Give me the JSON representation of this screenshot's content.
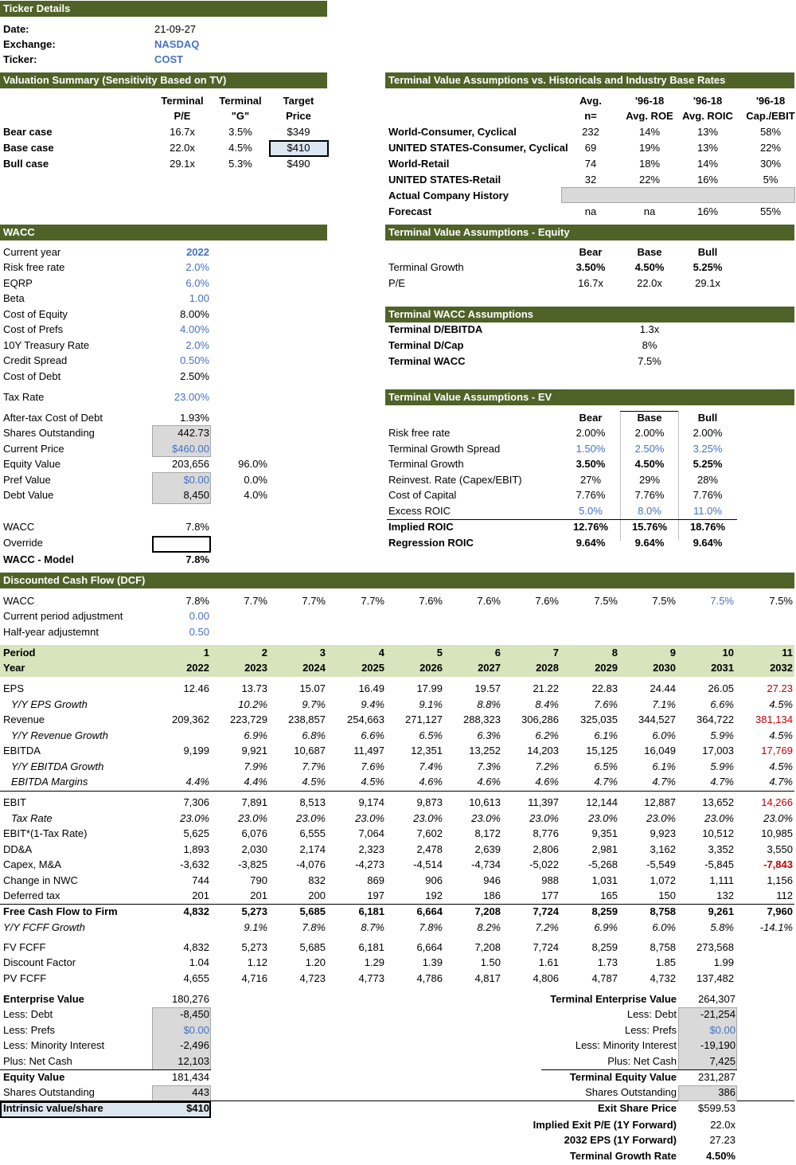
{
  "ticker": {
    "header": "Ticker Details",
    "date_label": "Date:",
    "date": "21-09-27",
    "exchange_label": "Exchange:",
    "exchange": "NASDAQ",
    "ticker_label": "Ticker:",
    "ticker": "COST"
  },
  "valuation": {
    "header": "Valuation Summary (Sensitivity Based on TV)",
    "col_headers": [
      [
        "Terminal",
        "P/E"
      ],
      [
        "Terminal",
        "\"G\""
      ],
      [
        "Target",
        "Price"
      ]
    ],
    "rows": [
      {
        "label": "Bear case",
        "pe": "16.7x",
        "g": "3.5%",
        "price": "$349"
      },
      {
        "label": "Base case",
        "pe": "22.0x",
        "g": "4.5%",
        "price": "$410"
      },
      {
        "label": "Bull case",
        "pe": "29.1x",
        "g": "5.3%",
        "price": "$490"
      }
    ]
  },
  "tv_hist": {
    "header": "Terminal Value Assumptions vs. Historicals and Industry Base Rates",
    "col_headers": [
      [
        "Avg.",
        "n="
      ],
      [
        "'96-18",
        "Avg. ROE"
      ],
      [
        "'96-18",
        "Avg. ROIC"
      ],
      [
        "'96-18",
        "Cap./EBIT"
      ]
    ],
    "rows": [
      {
        "label": "World-Consumer, Cyclical",
        "v": [
          "232",
          "14%",
          "13%",
          "58%"
        ]
      },
      {
        "label": "UNITED STATES-Consumer, Cyclical",
        "v": [
          "69",
          "19%",
          "13%",
          "22%"
        ]
      },
      {
        "label": "World-Retail",
        "v": [
          "74",
          "18%",
          "14%",
          "30%"
        ]
      },
      {
        "label": "UNITED STATES-Retail",
        "v": [
          "32",
          "22%",
          "16%",
          "5%"
        ]
      },
      {
        "label": "Actual Company History",
        "v": [
          "",
          "",
          "",
          ""
        ]
      },
      {
        "label": "Forecast",
        "v": [
          "na",
          "na",
          "16%",
          "55%"
        ]
      }
    ]
  },
  "wacc": {
    "header": "WACC",
    "rows": [
      {
        "label": "Current year",
        "value": "2022",
        "pct": ""
      },
      {
        "label": "Risk free rate",
        "value": "2.0%",
        "pct": ""
      },
      {
        "label": "EQRP",
        "value": "6.0%",
        "pct": ""
      },
      {
        "label": "Beta",
        "value": "1.00",
        "pct": ""
      },
      {
        "label": "Cost of Equity",
        "value": "8.00%",
        "pct": ""
      },
      {
        "label": "Cost of Prefs",
        "value": "4.00%",
        "pct": ""
      },
      {
        "label": "10Y Treasury Rate",
        "value": "2.0%",
        "pct": ""
      },
      {
        "label": "Credit Spread",
        "value": "0.50%",
        "pct": ""
      },
      {
        "label": "Cost of Debt",
        "value": "2.50%",
        "pct": ""
      },
      {
        "label": "Tax Rate",
        "value": "23.00%",
        "pct": ""
      },
      {
        "label": "After-tax Cost of Debt",
        "value": "1.93%",
        "pct": ""
      },
      {
        "label": "Shares Outstanding",
        "value": "442.73",
        "pct": ""
      },
      {
        "label": "Current Price",
        "value": "$460.00",
        "pct": ""
      },
      {
        "label": "Equity Value",
        "value": "203,656",
        "pct": "96.0%"
      },
      {
        "label": "Pref Value",
        "value": "$0.00",
        "pct": "0.0%"
      },
      {
        "label": "Debt Value",
        "value": "8,450",
        "pct": "4.0%"
      },
      {
        "label": "WACC",
        "value": "7.8%",
        "pct": ""
      },
      {
        "label": "Override",
        "value": "",
        "pct": ""
      },
      {
        "label": "WACC - Model",
        "value": "7.8%",
        "pct": ""
      }
    ]
  },
  "tv_equity": {
    "header": "Terminal Value Assumptions - Equity",
    "cols": [
      "Bear",
      "Base",
      "Bull"
    ],
    "rows": [
      {
        "label": "Terminal Growth",
        "v": [
          "3.50%",
          "4.50%",
          "5.25%"
        ]
      },
      {
        "label": "P/E",
        "v": [
          "16.7x",
          "22.0x",
          "29.1x"
        ]
      }
    ]
  },
  "tv_wacc": {
    "header": "Terminal WACC Assumptions",
    "rows": [
      {
        "label": "Terminal D/EBITDA",
        "value": "1.3x"
      },
      {
        "label": "Terminal D/Cap",
        "value": "8%"
      },
      {
        "label": "Terminal WACC",
        "value": "7.5%"
      }
    ]
  },
  "tv_ev": {
    "header": "Terminal Value Assumptions - EV",
    "cols": [
      "Bear",
      "Base",
      "Bull"
    ],
    "rows": [
      {
        "label": "Risk free rate",
        "v": [
          "2.00%",
          "2.00%",
          "2.00%"
        ]
      },
      {
        "label": "Terminal Growth Spread",
        "v": [
          "1.50%",
          "2.50%",
          "3.25%"
        ]
      },
      {
        "label": "Terminal Growth",
        "v": [
          "3.50%",
          "4.50%",
          "5.25%"
        ]
      },
      {
        "label": "Reinvest. Rate (Capex/EBIT)",
        "v": [
          "27%",
          "29%",
          "28%"
        ]
      },
      {
        "label": "Cost of Capital",
        "v": [
          "7.76%",
          "7.76%",
          "7.76%"
        ]
      },
      {
        "label": "Excess ROIC",
        "v": [
          "5.0%",
          "8.0%",
          "11.0%"
        ]
      },
      {
        "label": "Implied ROIC",
        "v": [
          "12.76%",
          "15.76%",
          "18.76%"
        ]
      },
      {
        "label": "Regression ROIC",
        "v": [
          "9.64%",
          "9.64%",
          "9.64%"
        ]
      }
    ]
  },
  "dcf": {
    "header": "Discounted Cash Flow (DCF)",
    "wacc_label": "WACC",
    "wacc_values": [
      "7.8%",
      "7.7%",
      "7.7%",
      "7.7%",
      "7.6%",
      "7.6%",
      "7.6%",
      "7.5%",
      "7.5%",
      "7.5%",
      "7.5%"
    ],
    "current_adj_label": "Current period adjustment",
    "current_adj": "0.00",
    "half_year_label": "Half-year adjustemnt",
    "half_year": "0.50",
    "period_label": "Period",
    "periods": [
      "1",
      "2",
      "3",
      "4",
      "5",
      "6",
      "7",
      "8",
      "9",
      "10",
      "11"
    ],
    "year_label": "Year",
    "years": [
      "2022",
      "2023",
      "2024",
      "2025",
      "2026",
      "2027",
      "2028",
      "2029",
      "2030",
      "2031",
      "2032"
    ],
    "rows": [
      {
        "label": "EPS",
        "v": [
          "12.46",
          "13.73",
          "15.07",
          "16.49",
          "17.99",
          "19.57",
          "21.22",
          "22.83",
          "24.44",
          "26.05",
          "27.23"
        ]
      },
      {
        "label": "Y/Y EPS Growth",
        "v": [
          "",
          "10.2%",
          "9.7%",
          "9.4%",
          "9.1%",
          "8.8%",
          "8.4%",
          "7.6%",
          "7.1%",
          "6.6%",
          "4.5%"
        ]
      },
      {
        "label": "Revenue",
        "v": [
          "209,362",
          "223,729",
          "238,857",
          "254,663",
          "271,127",
          "288,323",
          "306,286",
          "325,035",
          "344,527",
          "364,722",
          "381,134"
        ]
      },
      {
        "label": "Y/Y Revenue Growth",
        "v": [
          "",
          "6.9%",
          "6.8%",
          "6.6%",
          "6.5%",
          "6.3%",
          "6.2%",
          "6.1%",
          "6.0%",
          "5.9%",
          "4.5%"
        ]
      },
      {
        "label": "EBITDA",
        "v": [
          "9,199",
          "9,921",
          "10,687",
          "11,497",
          "12,351",
          "13,252",
          "14,203",
          "15,125",
          "16,049",
          "17,003",
          "17,769"
        ]
      },
      {
        "label": "Y/Y EBITDA Growth",
        "v": [
          "",
          "7.9%",
          "7.7%",
          "7.6%",
          "7.4%",
          "7.3%",
          "7.2%",
          "6.5%",
          "6.1%",
          "5.9%",
          "4.5%"
        ]
      },
      {
        "label": "EBITDA Margins",
        "v": [
          "4.4%",
          "4.4%",
          "4.5%",
          "4.5%",
          "4.6%",
          "4.6%",
          "4.6%",
          "4.7%",
          "4.7%",
          "4.7%",
          "4.7%"
        ]
      },
      {
        "label": "EBIT",
        "v": [
          "7,306",
          "7,891",
          "8,513",
          "9,174",
          "9,873",
          "10,613",
          "11,397",
          "12,144",
          "12,887",
          "13,652",
          "14,266"
        ]
      },
      {
        "label": "Tax Rate",
        "v": [
          "23.0%",
          "23.0%",
          "23.0%",
          "23.0%",
          "23.0%",
          "23.0%",
          "23.0%",
          "23.0%",
          "23.0%",
          "23.0%",
          "23.0%"
        ]
      },
      {
        "label": "EBIT*(1-Tax Rate)",
        "v": [
          "5,625",
          "6,076",
          "6,555",
          "7,064",
          "7,602",
          "8,172",
          "8,776",
          "9,351",
          "9,923",
          "10,512",
          "10,985"
        ]
      },
      {
        "label": "DD&A",
        "v": [
          "1,893",
          "2,030",
          "2,174",
          "2,323",
          "2,478",
          "2,639",
          "2,806",
          "2,981",
          "3,162",
          "3,352",
          "3,550"
        ]
      },
      {
        "label": "Capex, M&A",
        "v": [
          "-3,632",
          "-3,825",
          "-4,076",
          "-4,273",
          "-4,514",
          "-4,734",
          "-5,022",
          "-5,268",
          "-5,549",
          "-5,845",
          "-7,843"
        ]
      },
      {
        "label": "Change in NWC",
        "v": [
          "744",
          "790",
          "832",
          "869",
          "906",
          "946",
          "988",
          "1,031",
          "1,072",
          "1,111",
          "1,156"
        ]
      },
      {
        "label": "Deferred tax",
        "v": [
          "201",
          "201",
          "200",
          "197",
          "192",
          "186",
          "177",
          "165",
          "150",
          "132",
          "112"
        ]
      },
      {
        "label": "Free Cash Flow to Firm",
        "v": [
          "4,832",
          "5,273",
          "5,685",
          "6,181",
          "6,664",
          "7,208",
          "7,724",
          "8,259",
          "8,758",
          "9,261",
          "7,960"
        ]
      },
      {
        "label": "Y/Y FCFF Growth",
        "v": [
          "",
          "9.1%",
          "7.8%",
          "8.7%",
          "7.8%",
          "8.2%",
          "7.2%",
          "6.9%",
          "6.0%",
          "5.8%",
          "-14.1%"
        ]
      },
      {
        "label": "FV FCFF",
        "v": [
          "4,832",
          "5,273",
          "5,685",
          "6,181",
          "6,664",
          "7,208",
          "7,724",
          "8,259",
          "8,758",
          "273,568",
          ""
        ]
      },
      {
        "label": "Discount Factor",
        "v": [
          "1.04",
          "1.12",
          "1.20",
          "1.29",
          "1.39",
          "1.50",
          "1.61",
          "1.73",
          "1.85",
          "1.99",
          ""
        ]
      },
      {
        "label": "PV FCFF",
        "v": [
          "4,655",
          "4,716",
          "4,723",
          "4,773",
          "4,786",
          "4,817",
          "4,806",
          "4,787",
          "4,732",
          "137,482",
          ""
        ]
      }
    ]
  },
  "ev_bridge": [
    {
      "label": "Enterprise Value",
      "value": "180,276"
    },
    {
      "label": "Less: Debt",
      "value": "-8,450"
    },
    {
      "label": "Less: Prefs",
      "value": "$0.00"
    },
    {
      "label": "Less: Minority Interest",
      "value": "-2,496"
    },
    {
      "label": "Plus: Net Cash",
      "value": "12,103"
    },
    {
      "label": "Equity Value",
      "value": "181,434"
    },
    {
      "label": "Shares Outstanding",
      "value": "443"
    },
    {
      "label": "Intrinsic value/share",
      "value": "$410"
    }
  ],
  "terminal_bridge": [
    {
      "label": "Terminal Enterprise Value",
      "value": "264,307"
    },
    {
      "label": "Less: Debt",
      "value": "-21,254"
    },
    {
      "label": "Less: Prefs",
      "value": "$0.00"
    },
    {
      "label": "Less: Minority Interest",
      "value": "-19,190"
    },
    {
      "label": "Plus: Net Cash",
      "value": "7,425"
    },
    {
      "label": "Terminal Equity Value",
      "value": "231,287"
    },
    {
      "label": "Shares Outstanding",
      "value": "386"
    },
    {
      "label": "Exit Share Price",
      "value": "$599.53"
    },
    {
      "label": "Implied Exit P/E (1Y Forward)",
      "value": "22.0x"
    },
    {
      "label": "2032 EPS (1Y Forward)",
      "value": "27.23"
    },
    {
      "label": "Terminal Growth Rate",
      "value": "4.50%"
    }
  ],
  "colors": {
    "header_bg": "#4f6228",
    "period_bg": "#d8e4bc",
    "input_blue": "#4472c4",
    "input_gray": "#d9d9d9",
    "highlight_blue": "#dce6f1",
    "red": "#c00000"
  }
}
